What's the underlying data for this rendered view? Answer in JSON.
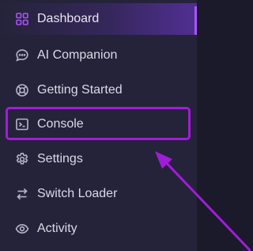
{
  "sidebar": {
    "items": [
      {
        "label": "Dashboard",
        "icon": "grid-icon",
        "active": true
      },
      {
        "label": "AI Companion",
        "icon": "chat-bubble-icon"
      },
      {
        "label": "Getting Started",
        "icon": "lifebuoy-icon"
      },
      {
        "label": "Console",
        "icon": "terminal-icon",
        "highlighted": true
      },
      {
        "label": "Settings",
        "icon": "gear-icon"
      },
      {
        "label": "Switch Loader",
        "icon": "swap-arrows-icon"
      },
      {
        "label": "Activity",
        "icon": "eye-icon"
      }
    ]
  },
  "colors": {
    "sidebar_bg": "#25233a",
    "page_bg": "#1b1a2b",
    "accent": "#a855f7",
    "annotation": "#a21bdb",
    "text": "#dcdae6"
  }
}
